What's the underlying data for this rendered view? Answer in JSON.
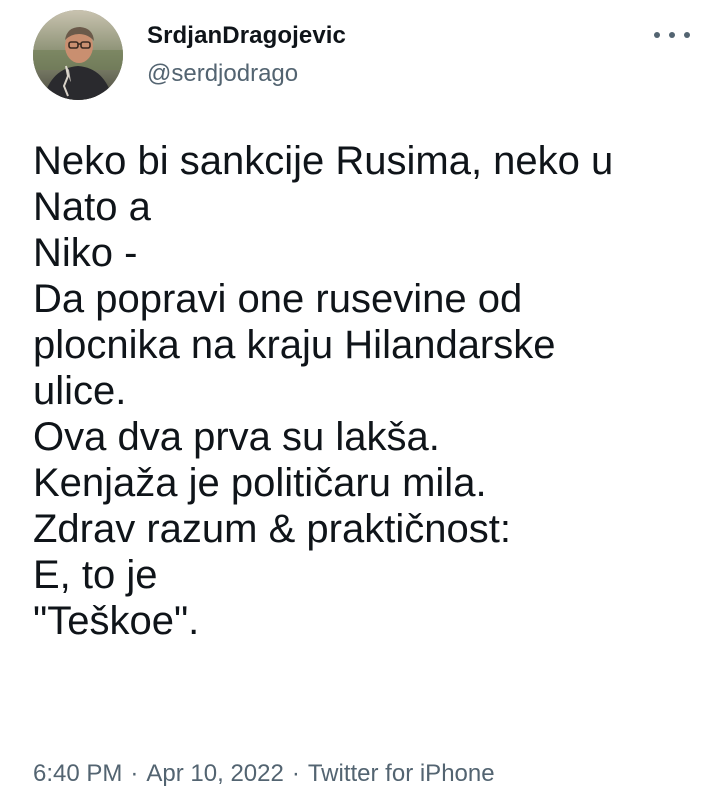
{
  "author": {
    "display_name": "SrdjanDragojevic",
    "handle": "@serdjodrago"
  },
  "tweet": {
    "lines": [
      "Neko bi sankcije Rusima, neko u",
      "Nato a",
      "Niko -",
      "Da popravi one rusevine od",
      "plocnika na kraju Hilandarske",
      "ulice.",
      "Ova dva prva su lakša.",
      "Kenjaža je političaru mila.",
      "Zdrav razum & praktičnost:",
      "E, to je",
      "\"Teškoe\"."
    ]
  },
  "meta": {
    "time": "6:40 PM",
    "separator": "·",
    "date": "Apr 10, 2022",
    "source": "Twitter for iPhone"
  },
  "icons": {
    "more": "more-dots-icon",
    "avatar": "profile-photo"
  },
  "colors": {
    "text": "#0f1419",
    "secondary": "#536471",
    "background": "#ffffff"
  }
}
